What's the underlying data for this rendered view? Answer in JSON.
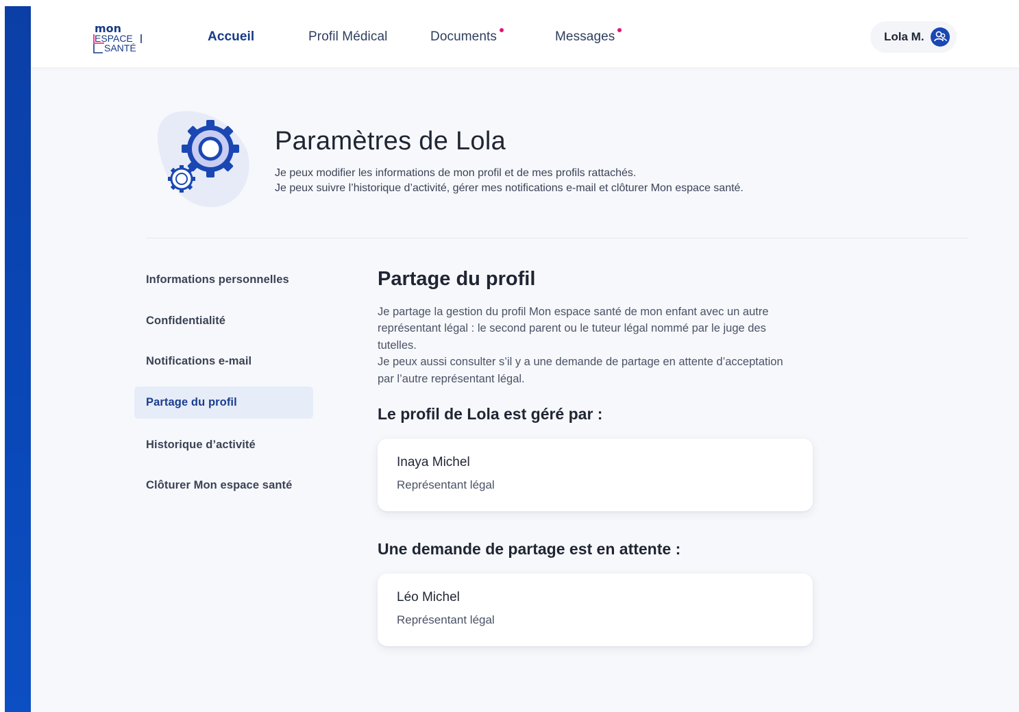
{
  "brand": {
    "logo_line1": "mon",
    "logo_line2": "ESPACE",
    "logo_line3": "SANTÉ",
    "primary_color": "#163a86",
    "accent_color": "#e3147a"
  },
  "nav": {
    "items": [
      {
        "label": "Accueil",
        "active": true,
        "notification": false
      },
      {
        "label": "Profil Médical",
        "active": false,
        "notification": false
      },
      {
        "label": "Documents",
        "active": false,
        "notification": true
      },
      {
        "label": "Messages",
        "active": false,
        "notification": true
      }
    ]
  },
  "user": {
    "name": "Lola M.",
    "icon": "user-switch-icon"
  },
  "hero": {
    "title": "Paramètres de Lola",
    "desc_line1": "Je peux modifier les informations de mon profil et de mes profils rattachés.",
    "desc_line2": "Je peux suivre l’historique d’activité, gérer mes notifications e-mail et clôturer Mon espace santé.",
    "icon": "gears-icon"
  },
  "sidebar": {
    "items": [
      {
        "label": "Informations personnelles",
        "active": false
      },
      {
        "label": "Confidentialité",
        "active": false
      },
      {
        "label": "Notifications e-mail",
        "active": false
      },
      {
        "label": "Partage du profil",
        "active": true
      },
      {
        "label": "Historique d’activité",
        "active": false
      },
      {
        "label": "Clôturer Mon espace santé",
        "active": false
      }
    ]
  },
  "content": {
    "title": "Partage du profil",
    "text_lines": [
      "Je partage la gestion du profil Mon espace santé de mon enfant avec un autre",
      "représentant légal : le second parent ou le tuteur légal nommé par le juge des",
      "tutelles.",
      "Je peux aussi consulter s’il y a une demande de partage en attente d’acceptation",
      "par l’autre représentant légal."
    ],
    "managed_title": "Le profil de Lola est géré par :",
    "managers": [
      {
        "name": "Inaya Michel",
        "role": "Représentant légal"
      }
    ],
    "pending_title": "Une demande de partage est en attente :",
    "pending": [
      {
        "name": "Léo Michel",
        "role": "Représentant légal"
      }
    ]
  }
}
